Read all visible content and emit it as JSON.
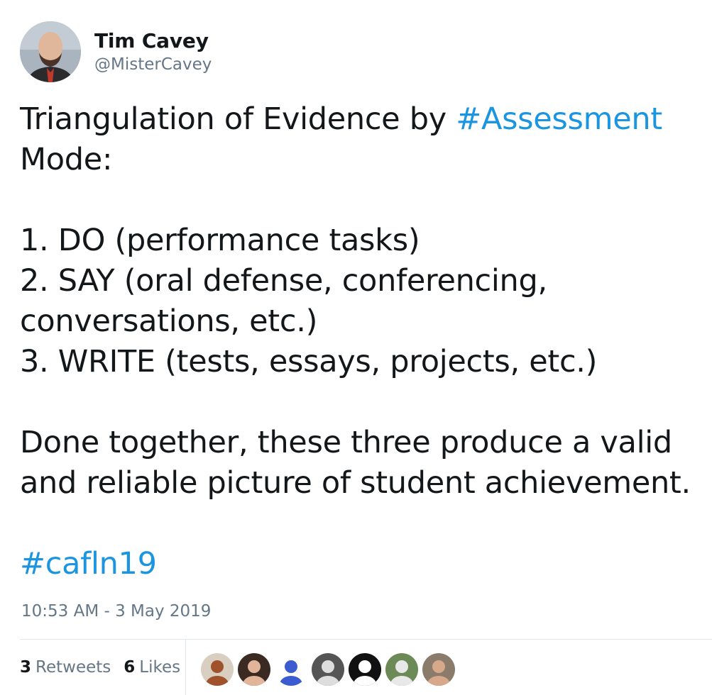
{
  "author": {
    "display_name": "Tim Cavey",
    "handle": "@MisterCavey",
    "avatar_icon": "user-avatar-photo"
  },
  "tweet": {
    "lines": [
      [
        {
          "text": "Triangulation of Evidence by ",
          "link": false
        },
        {
          "text": "#Assessment",
          "link": true
        }
      ],
      [
        {
          "text": "Mode:",
          "link": false
        }
      ],
      [],
      [
        {
          "text": "1. DO (performance tasks)",
          "link": false
        }
      ],
      [
        {
          "text": "2. SAY (oral defense, conferencing,",
          "link": false
        }
      ],
      [
        {
          "text": "conversations, etc.)",
          "link": false
        }
      ],
      [
        {
          "text": "3. WRITE (tests, essays, projects, etc.)",
          "link": false
        }
      ],
      [],
      [
        {
          "text": "Done together, these three produce a valid",
          "link": false
        }
      ],
      [
        {
          "text": "and reliable picture of student achievement.",
          "link": false
        }
      ],
      [],
      [
        {
          "text": "#cafln19",
          "link": true
        }
      ]
    ],
    "hashtag_color": "#1b95e0"
  },
  "timestamp": "10:53 AM - 3 May 2019",
  "stats": {
    "retweets_count": "3",
    "retweets_label": "Retweets",
    "likes_count": "6",
    "likes_label": "Likes"
  },
  "likers": [
    {
      "name": "liker-avatar-1",
      "bg": "#d9cfc0",
      "fg": "#a0522d"
    },
    {
      "name": "liker-avatar-2",
      "bg": "#3a2a22",
      "fg": "#e2b49a"
    },
    {
      "name": "liker-avatar-3",
      "bg": "#ffffff",
      "fg": "#3b5bd1"
    },
    {
      "name": "liker-avatar-4",
      "bg": "#555555",
      "fg": "#dddddd"
    },
    {
      "name": "liker-avatar-5",
      "bg": "#111111",
      "fg": "#ffffff"
    },
    {
      "name": "liker-avatar-6",
      "bg": "#6b8a55",
      "fg": "#e8e8e8"
    },
    {
      "name": "liker-avatar-7",
      "bg": "#8a7b6a",
      "fg": "#d8a88a"
    }
  ]
}
